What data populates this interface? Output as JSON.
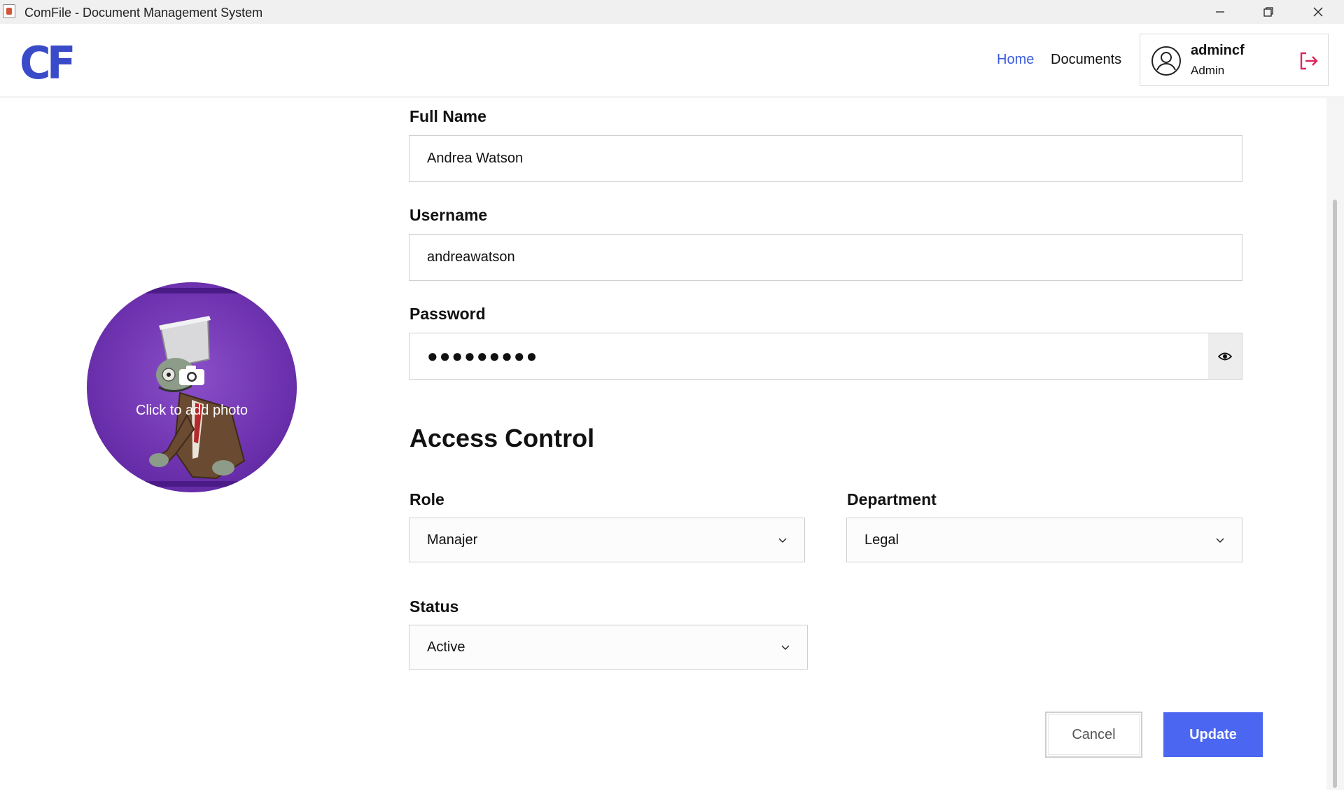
{
  "window": {
    "title": "ComFile - Document Management System",
    "icon": "java-app-icon",
    "controls": [
      "minimize-icon",
      "restore-icon",
      "close-icon"
    ]
  },
  "header": {
    "logo": "CF",
    "nav": [
      {
        "label": "Home",
        "active": true
      },
      {
        "label": "Documents",
        "active": false
      }
    ],
    "user": {
      "name": "admincf",
      "role": "Admin",
      "avatar_icon": "user-circle-icon",
      "logout_icon": "logout-icon"
    }
  },
  "photo": {
    "overlay_text": "Click to add photo",
    "icon": "camera-icon"
  },
  "form": {
    "full_name": {
      "label": "Full Name",
      "value": "Andrea Watson"
    },
    "username": {
      "label": "Username",
      "value": "andreawatson"
    },
    "password": {
      "label": "Password",
      "value": "●●●●●●●●●",
      "toggle_icon": "eye-icon"
    }
  },
  "access_control": {
    "title": "Access Control",
    "role": {
      "label": "Role",
      "value": "Manajer"
    },
    "department": {
      "label": "Department",
      "value": "Legal"
    },
    "status": {
      "label": "Status",
      "value": "Active"
    }
  },
  "actions": {
    "cancel": "Cancel",
    "update": "Update"
  },
  "colors": {
    "accent": "#4b66f0",
    "nav_active": "#3b5bdb",
    "logo": "#3a4bc9",
    "logout": "#e0245e"
  }
}
